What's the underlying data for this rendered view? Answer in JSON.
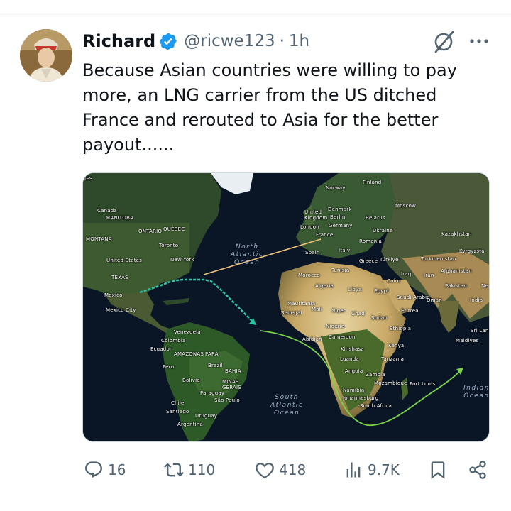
{
  "tweet": {
    "author_name": "Richard",
    "handle": "@ricwe123",
    "separator": "·",
    "time": "1h",
    "text": "Because Asian countries were willing to pay\nmore, an LNG carrier from the US ditched\nFrance and rerouted to Asia for the better\npayout......",
    "icons": {
      "avatar": "avatar",
      "verified": "verified-badge-icon",
      "grok": "grok-icon",
      "more": "more-icon"
    },
    "colors": {
      "verified": "#1d9bf0",
      "secondary_text": "#536471",
      "route_to_france": "#f0c27a",
      "route_us_gulf": "#2ec4a4",
      "route_to_asia": "#7ad34a"
    }
  },
  "map": {
    "labels": {
      "ies": "IES",
      "canada": "Canada",
      "manitoba": "MANITOBA",
      "ontario": "ONTARIO",
      "quebec": "QUÉBEC",
      "montana": "MONTANA",
      "toronto": "Toronto",
      "new_york": "New York",
      "united_states": "United States",
      "texas": "TEXAS",
      "mexico": "Mexico",
      "mexico_city": "Mexico City",
      "finland": "Finland",
      "norway": "Norway",
      "denmark": "Denmark",
      "united_kingdom": "United\nKingdom",
      "berlin": "Berlin",
      "germany": "Germany",
      "belarus": "Belarus",
      "moscow": "Moscow",
      "london": "London",
      "france": "France",
      "ukraine": "Ukraine",
      "kazakhstan": "Kazakhstan",
      "romania": "Romania",
      "kyrgyzstan": "Kyrgyzsta",
      "spain": "Spain",
      "italy": "Italy",
      "greece": "Greece",
      "turkey": "Türkiye",
      "turkmenistan": "Turkmenistan",
      "afghanistan": "Afghanistan",
      "morocco": "Morocco",
      "tunisia": "Tunisia",
      "iraq": "Iraq",
      "iran": "Iran",
      "algeria": "Algeria",
      "libya": "Libya",
      "egypt": "Egypt",
      "cairo": "Cairo",
      "pakistan": "Pakistan",
      "nep": "Nep",
      "mauritania": "Mauritania",
      "saudi_arabia": "Saudi Arabia",
      "oman": "Oman",
      "india": "India",
      "senegal": "Senegal",
      "mali": "Mali",
      "niger": "Niger",
      "chad": "Chad",
      "sudan": "Sudan",
      "eritrea": "Eritrea",
      "nigeria": "Nigeria",
      "ethiopia": "Ethiopia",
      "sri_lanka": "Sri Lanka",
      "abidjan": "Abidjan",
      "cameroon": "Cameroon",
      "kenya": "Kenya",
      "maldives": "Maldives",
      "kinshasa": "Kinshasa",
      "luanda": "Luanda",
      "tanzania": "Tanzania",
      "angola": "Angola",
      "zambia": "Zambia",
      "mozambique": "Mozambique",
      "port_louis": "Port Louis",
      "namibia": "Namibia",
      "johannesburg": "Johannesburg",
      "south_africa": "South Africa",
      "venezuela": "Venezuela",
      "colombia": "Colombia",
      "ecuador": "Ecuador",
      "amazonas": "AMAZONAS",
      "para": "PARÁ",
      "peru": "Peru",
      "brazil": "Brazil",
      "bahia": "BAHIA",
      "bolivia": "Bolivia",
      "minas_gerais": "MINAS\nGERAIS",
      "paraguay": "Paraguay",
      "sao_paulo": "São Paulo",
      "chile": "Chile",
      "santiago": "Santiago",
      "uruguay": "Uruguay",
      "argentina": "Argentina",
      "north_atlantic": "North\nAtlantic\nOcean",
      "south_atlantic": "South\nAtlantic\nOcean",
      "indian_ocean": "Indian\nOcean"
    }
  },
  "actions": {
    "reply_count": "16",
    "retweet_count": "110",
    "like_count": "418",
    "views_count": "9.7K",
    "icons": [
      "reply-icon",
      "retweet-icon",
      "like-icon",
      "views-icon",
      "bookmark-icon",
      "share-icon"
    ]
  }
}
